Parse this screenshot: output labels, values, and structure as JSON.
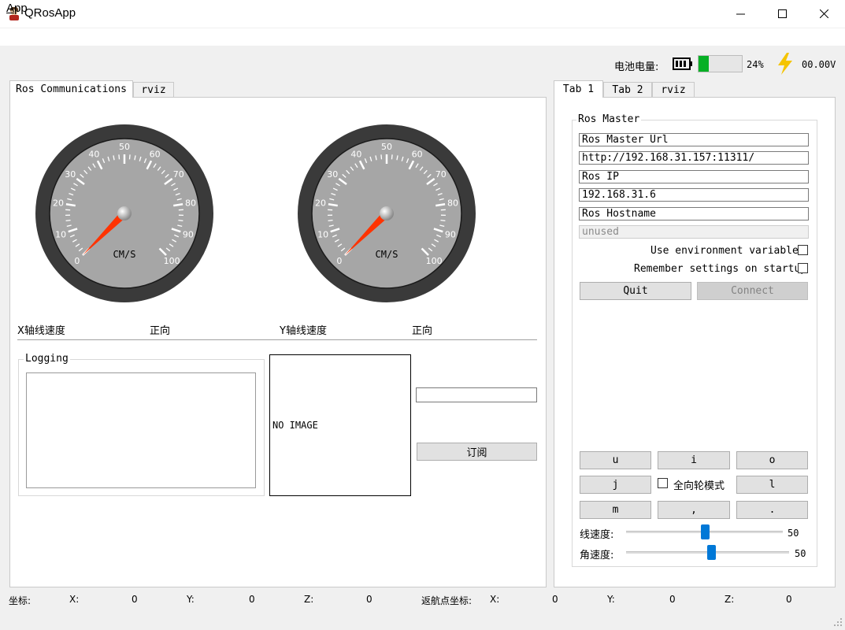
{
  "window": {
    "title": "QRosApp",
    "minimize": "–",
    "maximize": "☐",
    "close": "✕"
  },
  "menu": {
    "app_u": "A",
    "app_rest": "pp"
  },
  "battery": {
    "label": "电池电量:",
    "level": 0.24,
    "percent": "24%",
    "voltage": "00.00V",
    "fill_color": "#06b025"
  },
  "left_tabs": [
    "Ros Communications",
    "rviz"
  ],
  "gauges": {
    "unit": "CM/S",
    "ticks": [
      "0",
      "10",
      "20",
      "30",
      "40",
      "50",
      "60",
      "70",
      "80",
      "90",
      "100"
    ],
    "value": 0
  },
  "speed": {
    "x_label": "X轴线速度",
    "x_dir": "正向",
    "y_label": "Y轴线速度",
    "y_dir": "正向"
  },
  "logging": {
    "title": "Logging"
  },
  "image": {
    "placeholder": "NO IMAGE"
  },
  "subscribe_button": "订阅",
  "right_tabs": [
    "Tab 1",
    "Tab 2",
    "rviz"
  ],
  "ros_master": {
    "title": "Ros Master",
    "url_label": "Ros Master Url",
    "url_value": "http://192.168.31.157:11311/",
    "ip_label": "Ros IP",
    "ip_value": "192.168.31.6",
    "hostname_label": "Ros Hostname",
    "hostname_value": "unused",
    "env_label": "Use environment variables",
    "remember_label": "Remember settings on startup",
    "quit": "Quit",
    "connect": "Connect"
  },
  "keys": {
    "u": "u",
    "i": "i",
    "o": "o",
    "j": "j",
    "l": "l",
    "m": "m",
    "comma": ",",
    "dot": ".",
    "omni": "全向轮模式"
  },
  "sliders": {
    "linear_label": "线速度:",
    "linear_value": "50",
    "linear_fraction": 0.5,
    "angular_label": "角速度:",
    "angular_value": "50",
    "angular_fraction": 0.5
  },
  "status": {
    "coord_label": "坐标:",
    "x_label": "X:",
    "x": "0",
    "y_label": "Y:",
    "y": "0",
    "z_label": "Z:",
    "z": "0",
    "home_label": "返航点坐标:",
    "hx_label": "X:",
    "hx": "0",
    "hy_label": "Y:",
    "hy": "0",
    "hz_label": "Z:",
    "hz": "0"
  }
}
